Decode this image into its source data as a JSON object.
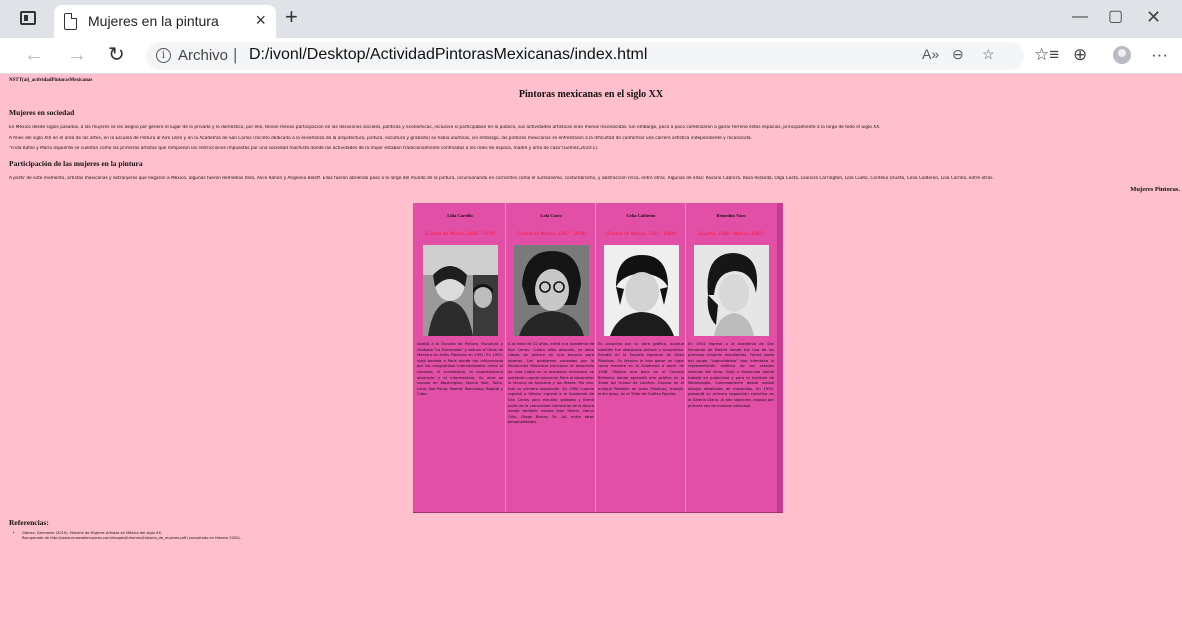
{
  "browser": {
    "tab_title": "Mujeres en la pintura",
    "url_scheme": "Archivo",
    "url_path": "D:/ivonl/Desktop/ActividadPintorasMexicanas/index.html",
    "accent": "#dfe3e8"
  },
  "page": {
    "label": "NSTT(ai)_actividadPintorasMexicanas",
    "title": "Pintoras mexicanas en el siglo XX",
    "section1": {
      "heading": "Mujeres en sociedad",
      "paragraphs": [
        "En México desde siglos pasados, a las mujeres se les asignó por género el lugar de lo privado y lo doméstico, por ello, tenían menos participación en las decisiones sociales, políticas y económicas, inclusive si participaban en lo público, sus actividades artísticas eran menos reconocidas. Sin embargo, poco a poco comenzaron a ganar terreno estos espacios, principalmente a lo largo de todo el Siglo XX.",
        "A fines del siglo XIX en el área de las artes, en la Escuela de Pintura al Aire Libre y en la Academia de San Carlos (recinto dedicado a la enseñanza de la arquitectura, pintura, escultura y grabado) se había alumnas, sin embargo, las pintoras mexicanas se enfrentaron a la dificultad de conformar una carrera artística independiente y reconocida.",
        "\"Frida Kahlo y María Izquierdo se cuentan como las primeras artistas que rompieron las restricciones impuestas por una sociedad machista donde las actividades de la mujer estaban tradicionalmente confinadas a los roles de esposa, madre y ama de casa\"(Gómez,2010:1)."
      ]
    },
    "section2": {
      "heading": "Participación de las mujeres en la pintura",
      "paragraph": "A partir de este momento, artistas mexicanas y extranjeras que llegaron a México, algunas fueron Remedios Varo, Alice Rahon y Angelina Beloff. Ellas fueron abriendo paso a lo largo del mundo de la pintura, incursionando en corrientes como el surrealismo, costumbrismo, y abstracción lírica, entre otras. Algunas de ellas: Rosario Cabrera, Rosa Rolanda, Olga Costa, Leonora Carrington, Lola Cueto, Cordelia Urueta, Celia Calderón, Lilia Carrillo, entre otras."
    },
    "side_label": "Mujeres Pintoras.",
    "painters": [
      {
        "name": "Lilia Carrillo",
        "info": "(Ciudad de México, 1930 - 1974)",
        "bio": "Asistió a la Escuela de Pintura, Escultura y Grabado \"La Esmeralda\" y obtuvo el título de Maestra en Artes Plásticas en 1951. En 1953, viajó becada a París donde fue influenciada por las vanguardias internacionales como el cubismo, el surrealismo, el expresionismo abstracto y el informalismo. Su obra se expuso en Washington, Nueva York, Tokio, Lima, Sao Paulo, Madrid, Barcelona, Bogotá y Cuba."
      },
      {
        "name": "Lola Cueto",
        "info": "(Ciudad de México, 1897 - 1978)",
        "bio": "A la edad de 12 años, entró a la Academia de San Carlos. Cuatro años después, ya daba clases de pintura en una escuela para obreras. Los problemas causados por la Revolución Mexicana truncaron el desarrollo de Lola Cueto en la academia mexicana, se adelantó cuando estuvo en París al desarrollar la técnica de tapicería y los títeres. Por ello, tras su primera exposición. En 1950 cuando regresó a México ingresó a la Academia de San Carlos para estudiar grabado y formó parte de la comunidad intelectual de la época donde también estaba Jean Martin, Nahui Ollin, Diego Rivera, Dr. Atl, entre otras personalidades."
      },
      {
        "name": "Celia Calderón",
        "info": "(Ciudad de México, 1921 - 1969)",
        "bio": "Es conocida por su obra gráfica, aunque también fue destacada pintora y acuarelista. Estudió en la Escuela Nacional de Artes Plásticas. Su técnica le hizo ganar un lugar como maestra en la Academia a partir de 1946. Obtuvo una beca en el Consejo Británico donde aprendió arte gráfico en la Slade Art School de Londres. Expuso en el antiguo Pabellón de Artes Plásticas, trabajó, entre otros, en el Taller de Gráfica Popular."
      },
      {
        "name": "Remedios Varo",
        "info": "(España, 1908 - México, 1963)",
        "bio": "En 1924 ingresó a la Academia de San Fernando de Madrid donde fue una de las primeras mujeres estudiantes. Formó parte del grupo \"Logicofobista\" que intentaba la representación estética de los estados internos del alma. Viajó a Venezuela donde trabajó en publicidad y para el Instituto de Malariología. Inmensamente desde realizó dibujos detallados de mosquitos. En 1955, presentó su primera exposición colectiva en la Galería Diana. Al año siguiente, expuso por primera vez de manera individual."
      }
    ],
    "references": {
      "heading": "Referencias:",
      "items": [
        "Gómez, Germaine (2010). Historia de Mujeres Artistas en México del siglo XX.",
        "Recuperado de http://www.museodemujeres.com/images/Informes/historia_de_mujeres.pdf (consultado en febrero 2020)."
      ]
    }
  }
}
